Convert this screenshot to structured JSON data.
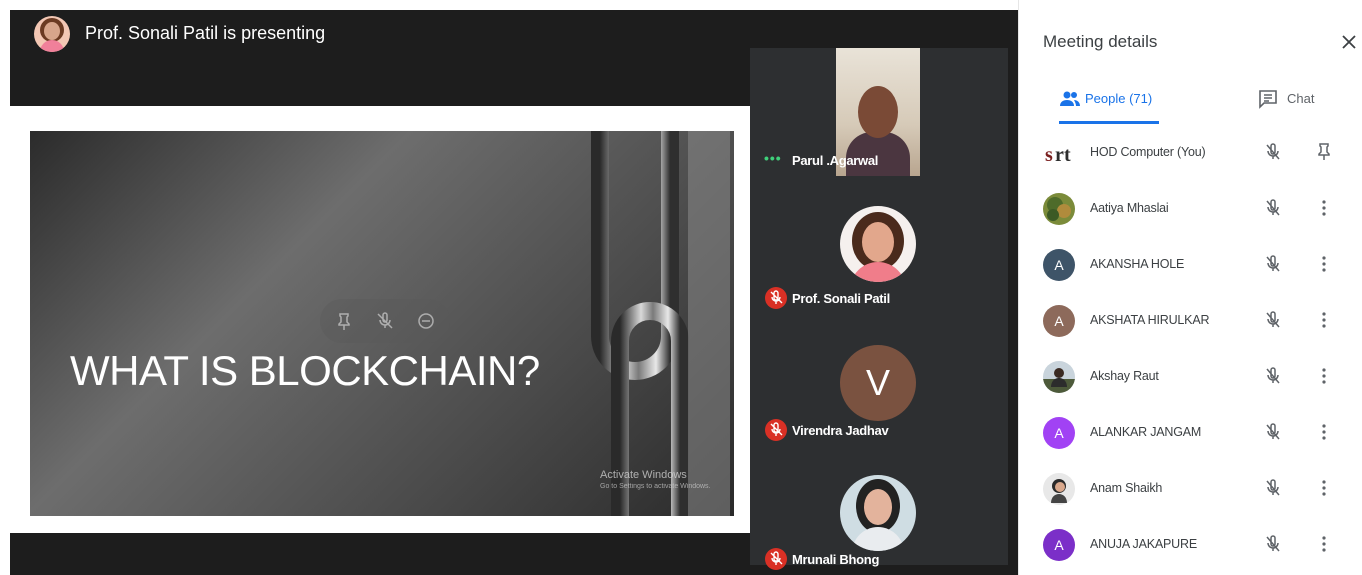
{
  "presenter_banner": {
    "text": "Prof. Sonali Patil is presenting"
  },
  "slide": {
    "title": "WHAT IS BLOCKCHAIN?",
    "watermark_line1": "Activate Windows",
    "watermark_line2": "Go to Settings to activate Windows."
  },
  "tiles": [
    {
      "name": "Parul .Agarwal",
      "status": "speaking-dots-icon"
    },
    {
      "name": "Prof. Sonali Patil",
      "status": "mic-off-icon"
    },
    {
      "name": "Virendra Jadhav",
      "status": "mic-off-icon",
      "initial": "V"
    },
    {
      "name": "Mrunali Bhong",
      "status": "mic-off-icon"
    }
  ],
  "panel": {
    "title": "Meeting details",
    "tabs": {
      "people": "People (71)",
      "chat": "Chat"
    },
    "people": [
      {
        "name": "HOD Computer (You)",
        "avatar": "srt"
      },
      {
        "name": "Aatiya Mhaslai",
        "avatar": "photo"
      },
      {
        "name": "AKANSHA HOLE",
        "avatar": "A"
      },
      {
        "name": "AKSHATA HIRULKAR",
        "avatar": "A"
      },
      {
        "name": "Akshay Raut",
        "avatar": "photo"
      },
      {
        "name": "ALANKAR JANGAM",
        "avatar": "A"
      },
      {
        "name": "Anam Shaikh",
        "avatar": "photo"
      },
      {
        "name": "ANUJA JAKAPURE",
        "avatar": "A"
      }
    ]
  },
  "colors": {
    "accent": "#1a73e8",
    "stage_bg": "#1d1d1d",
    "mic_off": "#d93025",
    "avatar_akansha": "#3e5468",
    "avatar_akshata": "#8d6a5b",
    "avatar_alankar": "#a142f4",
    "avatar_anuja": "#7b2fc8"
  }
}
